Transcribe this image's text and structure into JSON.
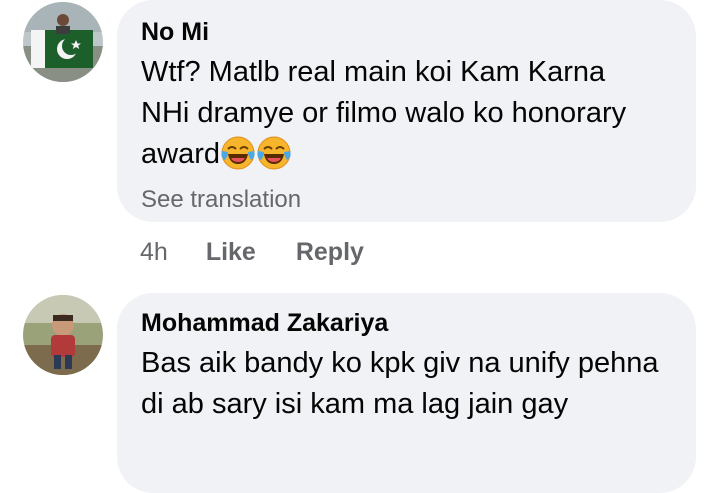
{
  "comments": [
    {
      "author": "No Mi",
      "text": "Wtf? Matlb real main koi Kam Karna NHi dramye or filmo walo ko honorary award",
      "emoji": [
        "face-with-tears-of-joy",
        "face-with-tears-of-joy"
      ],
      "see_translation": "See translation",
      "time": "4h",
      "like_label": "Like",
      "reply_label": "Reply"
    },
    {
      "author": "Mohammad Zakariya",
      "text": "Bas aik bandy ko kpk giv na unify pehna di ab sary isi kam ma lag jain gay"
    }
  ],
  "colors": {
    "bubble_bg": "#f0f2f5",
    "primary_text": "#050505",
    "secondary_text": "#65676b"
  }
}
